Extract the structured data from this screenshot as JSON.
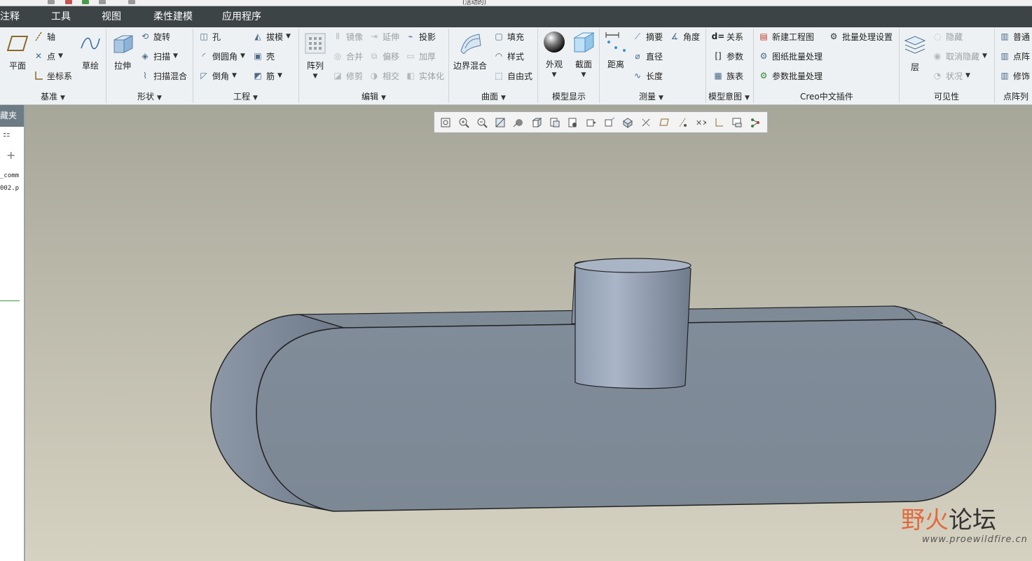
{
  "window": {
    "title": "(活动的)"
  },
  "menubar": [
    "注释",
    "工具",
    "视图",
    "柔性建模",
    "应用程序"
  ],
  "ribbon": {
    "datum": {
      "plane": "平面",
      "axis": "轴",
      "point": "点",
      "csys": "坐标系",
      "sketch": "草绘",
      "label": "基准"
    },
    "shapes": {
      "extrude": "拉伸",
      "revolve": "旋转",
      "sweep": "扫描",
      "swept_blend": "扫描混合",
      "label": "形状"
    },
    "engineering": {
      "hole": "孔",
      "round": "倒圆角",
      "chamfer": "倒角",
      "draft": "拔模",
      "shell": "壳",
      "rib": "筋",
      "label": "工程"
    },
    "editing": {
      "pattern": "阵列",
      "mirror": "镜像",
      "merge": "合并",
      "trim": "修剪",
      "extend": "延伸",
      "offset": "偏移",
      "intersect": "相交",
      "project": "投影",
      "thicken": "加厚",
      "solidify": "实体化",
      "label": "编辑"
    },
    "surfaces": {
      "boundary_blend": "边界混合",
      "fill": "填充",
      "style": "样式",
      "freestyle": "自由式",
      "label": "曲面"
    },
    "model_display": {
      "appearance": "外观",
      "section": "截面",
      "label": "模型显示"
    },
    "measure": {
      "distance": "距离",
      "summary": "摘要",
      "diameter": "直径",
      "length": "长度",
      "angle": "角度",
      "label": "测量"
    },
    "model_intent": {
      "relations": "关系",
      "parameters": "参数",
      "family_table": "族表",
      "label": "模型意图"
    },
    "creo_plugin": {
      "new_drawing": "新建工程图",
      "batch_settings": "批量处理设置",
      "drawing_batch": "图纸批量处理",
      "param_batch": "参数批量处理",
      "label": "Creo中文插件"
    },
    "visibility": {
      "layers": "层",
      "hide": "隐藏",
      "unhide": "取消隐藏",
      "status": "状况",
      "label": "可见性"
    },
    "point_array": {
      "item1": "普通",
      "item2": "点阵",
      "item3": "修饰",
      "label": "点阵列"
    }
  },
  "left_panel": {
    "header": "藏夹",
    "file1": "_comm",
    "file2": "002.p"
  },
  "view_toolbar_icons": [
    "refit-icon",
    "zoom-in-icon",
    "zoom-out-icon",
    "repaint-icon",
    "display-style-icon",
    "saved-views-icon",
    "view-manager-icon",
    "perspective-icon",
    "spin-center-icon",
    "annotation-display-icon",
    "datum-display-icon",
    "plane-display-icon",
    "axis-display-icon",
    "point-display-icon",
    "csys-display-icon",
    "annotation-filter-icon",
    "appearance-icon",
    "section-icon"
  ],
  "watermark": {
    "cn_part1": "野火",
    "cn_part2": "论坛",
    "url": "www.proewildfire.cn"
  },
  "colors": {
    "menubar": "#3c4446",
    "ribbon": "#eef1f3",
    "model_face": "#7f8b98"
  }
}
